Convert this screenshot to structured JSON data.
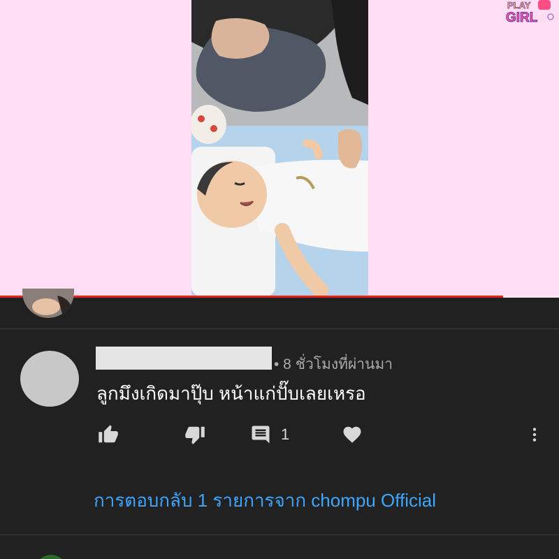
{
  "player": {
    "channel_logo_text": [
      "PLAY",
      "GIRL"
    ],
    "progress_fraction": 0.9
  },
  "comment": {
    "timestamp": "• 8 ชั่วโมงที่ผ่านมา",
    "text": "ลูกมึงเกิดมาปุ๊บ หน้าแก่ปั๊บเลยเหรอ",
    "actions": {
      "like_icon": "thumb-up-icon",
      "dislike_icon": "thumb-down-icon",
      "reply_icon": "comment-icon",
      "reply_count": "1",
      "heart_icon": "heart-icon",
      "more_icon": "more-vert-icon"
    },
    "view_replies": "การตอบกลับ 1 รายการจาก chompu Official"
  },
  "colors": {
    "background": "#212121",
    "player_background": "#ffdef5",
    "link": "#3ea6ff",
    "progress": "#e62117",
    "secondary_text": "#aaaaaa"
  }
}
